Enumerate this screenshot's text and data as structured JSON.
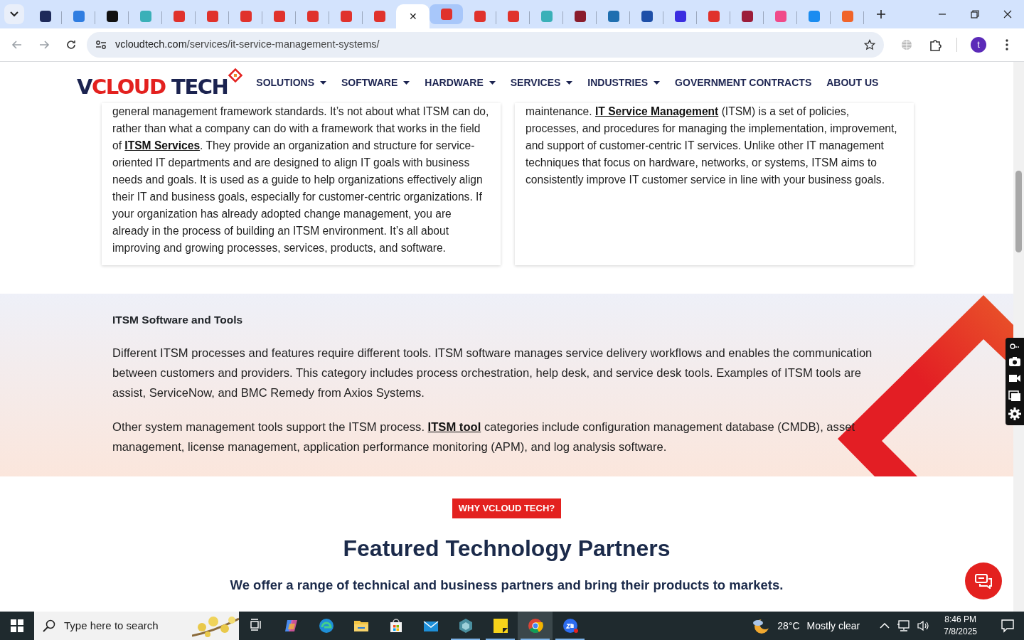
{
  "browser": {
    "tabs": [
      {
        "selected": false,
        "highlighted": false,
        "color": "#1e2a5a"
      },
      {
        "selected": false,
        "highlighted": false,
        "color": "#2f7de1"
      },
      {
        "selected": false,
        "highlighted": false,
        "color": "#111111"
      },
      {
        "selected": false,
        "highlighted": false,
        "color": "#3ab0b8"
      },
      {
        "selected": false,
        "highlighted": false,
        "color": "#e0322c"
      },
      {
        "selected": false,
        "highlighted": false,
        "color": "#e0322c"
      },
      {
        "selected": false,
        "highlighted": false,
        "color": "#e0322c"
      },
      {
        "selected": false,
        "highlighted": false,
        "color": "#e0322c"
      },
      {
        "selected": false,
        "highlighted": false,
        "color": "#e0322c"
      },
      {
        "selected": false,
        "highlighted": false,
        "color": "#e0322c"
      },
      {
        "selected": false,
        "highlighted": false,
        "color": "#e0322c"
      },
      {
        "selected": true,
        "highlighted": false,
        "close": "✕"
      },
      {
        "selected": false,
        "highlighted": true,
        "color": "#e0322c"
      },
      {
        "selected": false,
        "highlighted": false,
        "color": "#e0322c"
      },
      {
        "selected": false,
        "highlighted": false,
        "color": "#e0322c"
      },
      {
        "selected": false,
        "highlighted": false,
        "color": "#3ab0b8"
      },
      {
        "selected": false,
        "highlighted": false,
        "color": "#8a1c2c"
      },
      {
        "selected": false,
        "highlighted": false,
        "color": "#1f6fb0"
      },
      {
        "selected": false,
        "highlighted": false,
        "color": "#1e4fa8"
      },
      {
        "selected": false,
        "highlighted": false,
        "color": "#3a2de0"
      },
      {
        "selected": false,
        "highlighted": false,
        "color": "#e0322c"
      },
      {
        "selected": false,
        "highlighted": false,
        "color": "#9c1d3a"
      },
      {
        "selected": false,
        "highlighted": false,
        "color": "#f04a8a"
      },
      {
        "selected": false,
        "highlighted": false,
        "color": "#1a8cf0"
      },
      {
        "selected": false,
        "highlighted": false,
        "color": "#f0642a"
      }
    ],
    "url_domain": "vcloudtech.com",
    "url_path": "/services/it-service-management-systems/",
    "avatar": "t"
  },
  "site": {
    "logo": "VCLOUD TECH",
    "nav": [
      {
        "label": "SOLUTIONS",
        "dropdown": true
      },
      {
        "label": "SOFTWARE",
        "dropdown": true
      },
      {
        "label": "HARDWARE",
        "dropdown": true
      },
      {
        "label": "SERVICES",
        "dropdown": true
      },
      {
        "label": "INDUSTRIES",
        "dropdown": true
      },
      {
        "label": "GOVERNMENT CONTRACTS",
        "dropdown": false
      },
      {
        "label": "ABOUT US",
        "dropdown": false
      }
    ]
  },
  "cards": [
    {
      "segments": [
        {
          "kind": "text",
          "text": "general management framework standards. It’s not about what ITSM can do, rather than what a company can do with a framework that works in the field of "
        },
        {
          "kind": "link",
          "text": "ITSM Services"
        },
        {
          "kind": "text",
          "text": ". They provide an organization and structure for service-oriented IT departments and are designed to align IT goals with business needs and goals. It is used as a guide to help organizations effectively align their IT and business goals, especially for customer-centric organizations. If your organization has already adopted change management, you are already in the process of building an ITSM environment. It’s all about improving and growing processes, services, products, and software."
        }
      ]
    },
    {
      "segments": [
        {
          "kind": "text",
          "text": "maintenance. "
        },
        {
          "kind": "link",
          "text": "IT Service Management"
        },
        {
          "kind": "text",
          "text": " (ITSM) is a set of policies, processes, and procedures for managing the implementation, improvement, and support of customer-centric IT services. Unlike other IT management techniques that focus on hardware, networks, or systems, ITSM aims to consistently improve IT customer service in line with your business goals."
        }
      ]
    }
  ],
  "tools_section": {
    "heading": "ITSM Software and Tools",
    "paragraphs": [
      [
        {
          "kind": "text",
          "text": "Different ITSM processes and features require different tools. ITSM software manages service delivery workflows and enables the communication between customers and providers. This category includes process orchestration, help desk, and service desk tools. Examples of ITSM tools are assist, ServiceNow, and BMC Remedy from Axios Systems."
        }
      ],
      [
        {
          "kind": "text",
          "text": "Other system management tools support the ITSM process. "
        },
        {
          "kind": "link",
          "text": "ITSM tool"
        },
        {
          "kind": "text",
          "text": " categories include configuration management database (CMDB), asset management, license management, application performance monitoring (APM), and log analysis software."
        }
      ]
    ]
  },
  "partners": {
    "badge": "WHY VCLOUD TECH?",
    "heading": "Featured Technology Partners",
    "subheading": "We offer a range of technical and business partners and bring their products to markets."
  },
  "taskbar": {
    "search_placeholder": "Type here to search",
    "apps": [
      {
        "kind": "taskview",
        "running": false,
        "active": false
      },
      {
        "kind": "copilot",
        "running": false,
        "active": false
      },
      {
        "kind": "edge",
        "running": false,
        "active": false
      },
      {
        "kind": "folder",
        "running": false,
        "active": false
      },
      {
        "kind": "store",
        "running": false,
        "active": false
      },
      {
        "kind": "mail",
        "running": false,
        "active": false
      },
      {
        "kind": "cube",
        "running": true,
        "active": false
      },
      {
        "kind": "notes",
        "running": true,
        "active": false
      },
      {
        "kind": "chrome",
        "running": true,
        "active": true
      },
      {
        "kind": "zoom",
        "running": true,
        "active": false
      }
    ],
    "temperature": "28°C",
    "weather": "Mostly clear",
    "time": "8:46 PM",
    "date": "7/8/2025"
  }
}
